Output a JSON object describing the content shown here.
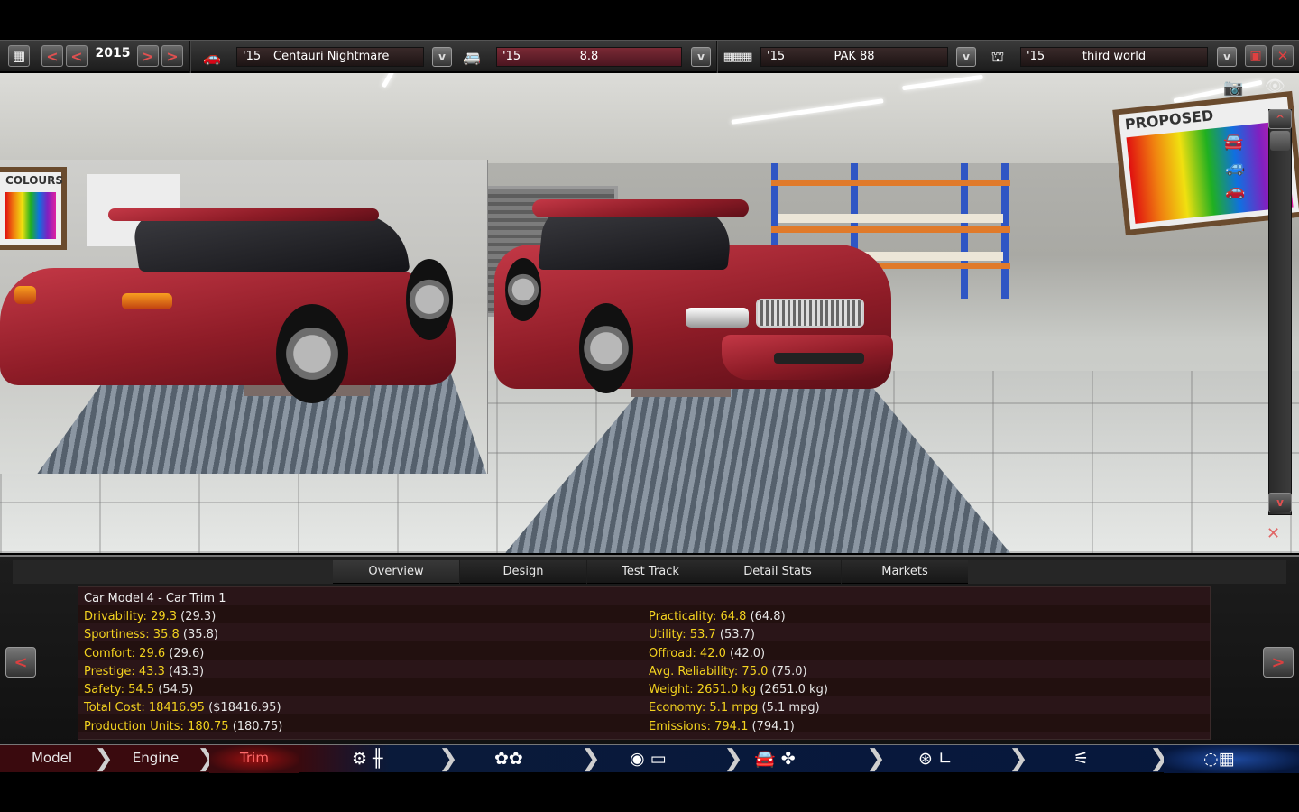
{
  "toolbar": {
    "year": "2015",
    "prev_label": "<",
    "next_label": ">",
    "dropdown_label": "v",
    "selectors": [
      {
        "year": "'15",
        "name": "Centauri Nightmare",
        "icon": "car-icon"
      },
      {
        "year": "'15",
        "name": "8.8",
        "icon": "truck-icon"
      },
      {
        "year": "'15",
        "name": "PAK 88",
        "icon": "engine-icon"
      },
      {
        "year": "'15",
        "name": "third world",
        "icon": "factory-icon"
      }
    ],
    "save_icon": "save-icon",
    "close_icon": "close-icon"
  },
  "viewport": {
    "scroll_up_label": "^",
    "scroll_down_label": "v",
    "boards": [
      "COLOURS",
      "PROPOSED"
    ],
    "view_icons": [
      "camera-icon",
      "eye-icon",
      "car-side-icon",
      "car-front-icon",
      "car-top-icon",
      "reset-view-icon"
    ]
  },
  "tabs": [
    "Overview",
    "Design",
    "Test Track",
    "Detail Stats",
    "Markets"
  ],
  "active_tab": "Overview",
  "stats": {
    "title": "Car Model 4 - Car Trim 1",
    "left": [
      {
        "label": "Drivability: 29.3",
        "value": "(29.3)"
      },
      {
        "label": "Sportiness: 35.8",
        "value": "(35.8)"
      },
      {
        "label": "Comfort: 29.6",
        "value": "(29.6)"
      },
      {
        "label": "Prestige: 43.3",
        "value": "(43.3)"
      },
      {
        "label": "Safety: 54.5",
        "value": "(54.5)"
      },
      {
        "label": "Total Cost: 18416.95",
        "value": "($18416.95)"
      },
      {
        "label": "Production Units: 180.75",
        "value": "(180.75)"
      }
    ],
    "right": [
      {
        "label": "Practicality: 64.8",
        "value": "(64.8)"
      },
      {
        "label": "Utility: 53.7",
        "value": "(53.7)"
      },
      {
        "label": "Offroad: 42.0",
        "value": "(42.0)"
      },
      {
        "label": "Avg. Reliability: 75.0",
        "value": "(75.0)"
      },
      {
        "label": "Weight: 2651.0 kg",
        "value": "(2651.0 kg)"
      },
      {
        "label": "Economy: 5.1 mpg",
        "value": "(5.1 mpg)"
      },
      {
        "label": "Emissions: 794.1",
        "value": "(794.1)"
      }
    ]
  },
  "nav": {
    "prev_label": "<",
    "next_label": ">"
  },
  "workflow": {
    "steps": [
      "Model",
      "Engine",
      "Trim"
    ],
    "current": "Trim",
    "icon_steps": [
      "wheel-gear-icon",
      "tires-icon",
      "body-icon",
      "car-fan-icon",
      "interior-icon",
      "suspension-icon",
      "finish-flag-icon"
    ]
  }
}
